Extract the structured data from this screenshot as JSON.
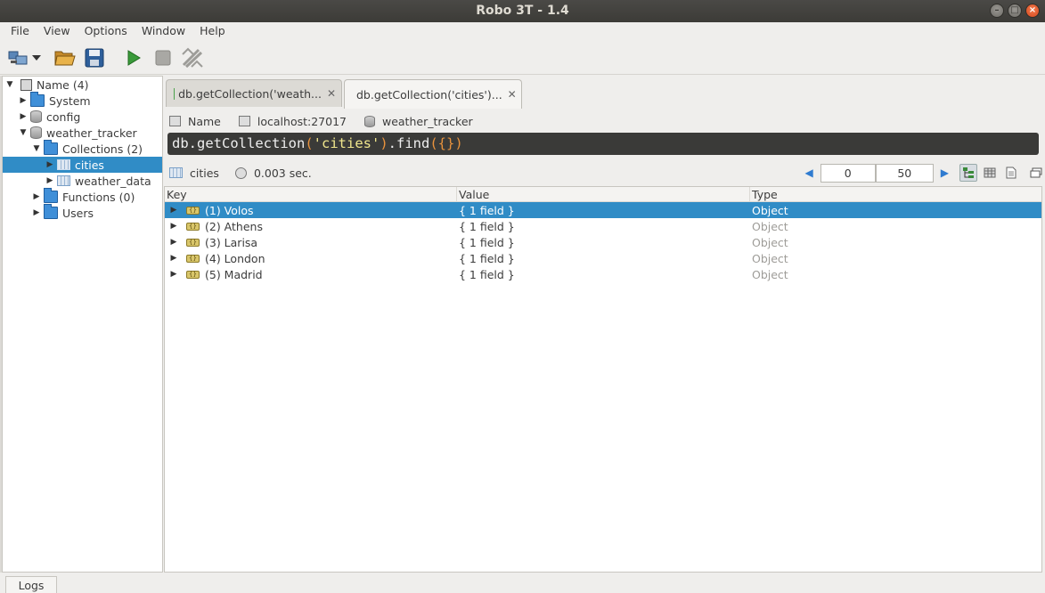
{
  "window": {
    "title": "Robo 3T - 1.4"
  },
  "menu": [
    "File",
    "View",
    "Options",
    "Window",
    "Help"
  ],
  "toolbar": {
    "icons": [
      "connect-icon",
      "dropdown-arrow-icon",
      "open-folder-icon",
      "save-icon",
      "execute-icon",
      "stop-icon",
      "format-icon"
    ]
  },
  "sidebar": {
    "items": [
      {
        "label": "Name (4)",
        "icon": "server-icon",
        "arrow": "▼",
        "indent": 0,
        "selected": false
      },
      {
        "label": "System",
        "icon": "folder-icon",
        "arrow": "▶",
        "indent": 1,
        "selected": false
      },
      {
        "label": "config",
        "icon": "database-icon",
        "arrow": "▶",
        "indent": 1,
        "selected": false
      },
      {
        "label": "weather_tracker",
        "icon": "database-icon",
        "arrow": "▼",
        "indent": 1,
        "selected": false
      },
      {
        "label": "Collections (2)",
        "icon": "folder-icon",
        "arrow": "▼",
        "indent": 2,
        "selected": false
      },
      {
        "label": "cities",
        "icon": "collection-icon",
        "arrow": "▶",
        "indent": 3,
        "selected": true
      },
      {
        "label": "weather_data",
        "icon": "collection-icon",
        "arrow": "▶",
        "indent": 3,
        "selected": false
      },
      {
        "label": "Functions (0)",
        "icon": "folder-icon",
        "arrow": "▶",
        "indent": 2,
        "selected": false
      },
      {
        "label": "Users",
        "icon": "folder-icon",
        "arrow": "▶",
        "indent": 2,
        "selected": false
      }
    ]
  },
  "tabs": [
    {
      "label": "db.getCollection('weath...",
      "active": false
    },
    {
      "label": "db.getCollection('cities')...",
      "active": true
    }
  ],
  "info": {
    "connection": "Name",
    "host": "localhost:27017",
    "database": "weather_tracker"
  },
  "query": {
    "prefix": "db.getCollection",
    "open": "(",
    "arg": "'cities'",
    "close": ")",
    "method": ".find",
    "args": "({})"
  },
  "results": {
    "collection": "cities",
    "time": "0.003 sec.",
    "skip": "0",
    "limit": "50",
    "columns": [
      "Key",
      "Value",
      "Type"
    ],
    "rows": [
      {
        "key": "(1) Volos",
        "value": "{ 1 field }",
        "type": "Object",
        "selected": true
      },
      {
        "key": "(2) Athens",
        "value": "{ 1 field }",
        "type": "Object",
        "selected": false
      },
      {
        "key": "(3) Larisa",
        "value": "{ 1 field }",
        "type": "Object",
        "selected": false
      },
      {
        "key": "(4) London",
        "value": "{ 1 field }",
        "type": "Object",
        "selected": false
      },
      {
        "key": "(5) Madrid",
        "value": "{ 1 field }",
        "type": "Object",
        "selected": false
      }
    ]
  },
  "status": {
    "logs_tab": "Logs"
  }
}
